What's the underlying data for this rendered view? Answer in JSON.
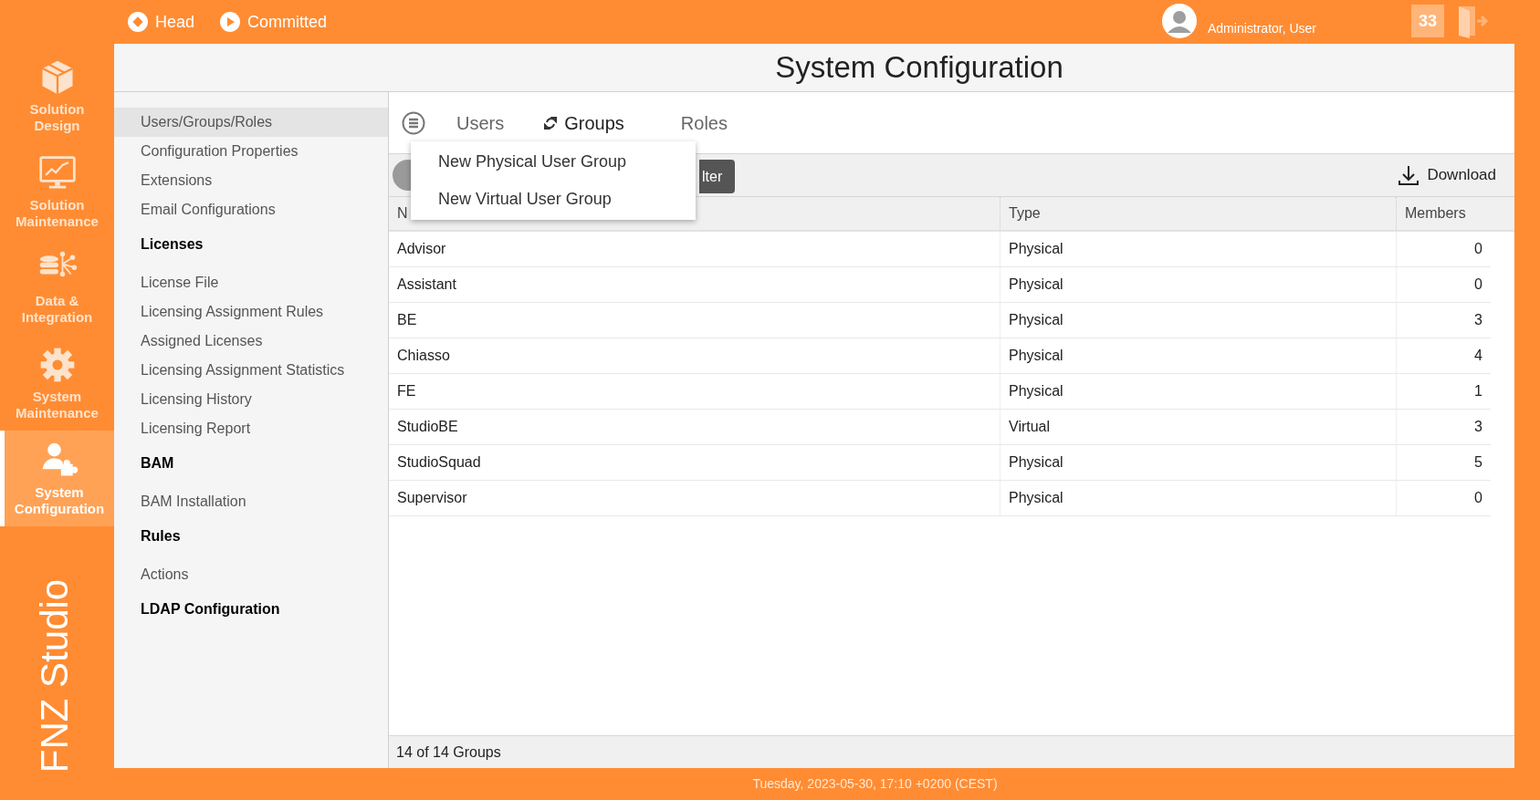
{
  "top_bar": {
    "branches": [
      {
        "kind": "head",
        "label": "Head"
      },
      {
        "kind": "committed",
        "label": "Committed"
      }
    ],
    "user_role": "Administrator, User",
    "notification_count": "33"
  },
  "rail": [
    {
      "kind": "box",
      "label": "Solution Design",
      "selected": false
    },
    {
      "kind": "monitor",
      "label": "Solution Maintenance",
      "selected": false
    },
    {
      "kind": "data",
      "label": "Data & Integration",
      "selected": false
    },
    {
      "kind": "gear",
      "label": "System Maintenance",
      "selected": false
    },
    {
      "kind": "user-puzzle",
      "label": "System Configuration",
      "selected": true
    }
  ],
  "brand": "FNZ Studio",
  "page_title": "System Configuration",
  "nav": [
    {
      "kind": "link",
      "label": "Users/Groups/Roles",
      "selected": true
    },
    {
      "kind": "link",
      "label": "Configuration Properties",
      "selected": false
    },
    {
      "kind": "link",
      "label": "Extensions",
      "selected": false
    },
    {
      "kind": "link",
      "label": "Email Configurations",
      "selected": false
    },
    {
      "kind": "heading",
      "label": "Licenses"
    },
    {
      "kind": "link",
      "label": "License File",
      "selected": false
    },
    {
      "kind": "link",
      "label": "Licensing Assignment Rules",
      "selected": false
    },
    {
      "kind": "link",
      "label": "Assigned Licenses",
      "selected": false
    },
    {
      "kind": "link",
      "label": "Licensing Assignment Statistics",
      "selected": false
    },
    {
      "kind": "link",
      "label": "Licensing History",
      "selected": false
    },
    {
      "kind": "link",
      "label": "Licensing Report",
      "selected": false
    },
    {
      "kind": "heading",
      "label": "BAM"
    },
    {
      "kind": "link",
      "label": "BAM Installation",
      "selected": false
    },
    {
      "kind": "heading",
      "label": "Rules"
    },
    {
      "kind": "link",
      "label": "Actions",
      "selected": false
    },
    {
      "kind": "heading",
      "label": "LDAP Configuration"
    }
  ],
  "tabs": [
    {
      "label": "Users",
      "selected": false
    },
    {
      "label": "Groups",
      "selected": true
    },
    {
      "label": "Roles",
      "selected": false
    }
  ],
  "dropdown_menu": [
    "New Physical User Group",
    "New Virtual User Group"
  ],
  "toolbar": {
    "filter_button": "lter",
    "download_button": "Download"
  },
  "table": {
    "columns": [
      "N",
      "Type",
      "Members"
    ],
    "rows": [
      [
        "Advisor",
        "Physical",
        "0"
      ],
      [
        "Assistant",
        "Physical",
        "0"
      ],
      [
        "BE",
        "Physical",
        "3"
      ],
      [
        "Chiasso",
        "Physical",
        "4"
      ],
      [
        "FE",
        "Physical",
        "1"
      ],
      [
        "StudioBE",
        "Virtual",
        "3"
      ],
      [
        "StudioSquad",
        "Physical",
        "5"
      ],
      [
        "Supervisor",
        "Physical",
        "0"
      ]
    ]
  },
  "footer": "14 of 14 Groups",
  "status_bar": "Tuesday, 2023-05-30, 17:10 +0200 (CEST)"
}
